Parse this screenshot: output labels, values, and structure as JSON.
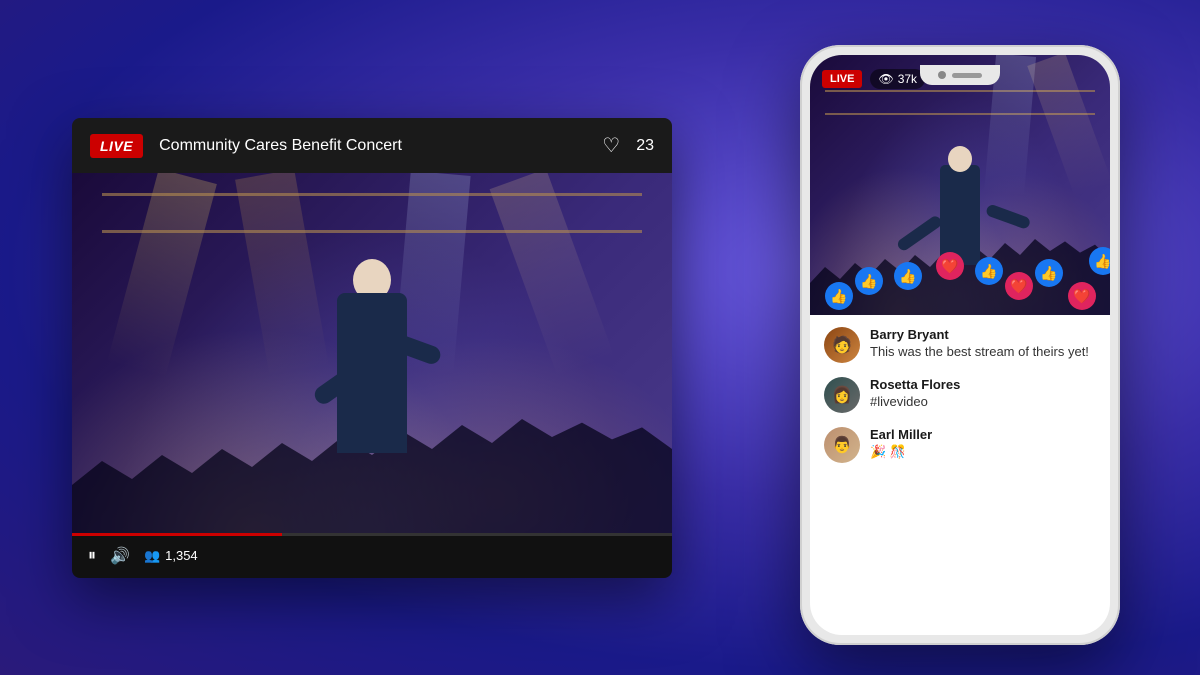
{
  "desktop_player": {
    "live_badge": "LIVE",
    "title": "Community Cares Benefit Concert",
    "heart_icon": "♡",
    "like_count": "23",
    "pause_icon": "⏸",
    "volume_icon": "🔊",
    "viewer_icon": "👥",
    "viewer_count": "1,354",
    "progress_pct": 35
  },
  "phone": {
    "live_badge": "LIVE",
    "viewer_icon": "👁",
    "viewer_count": "37k",
    "reactions": [
      "👍",
      "👍",
      "👍",
      "❤️",
      "👍",
      "❤️",
      "👍",
      "❤️",
      "👍"
    ],
    "comments": [
      {
        "name": "Barry Bryant",
        "text": "This was the best stream of theirs yet!",
        "avatar": "barry"
      },
      {
        "name": "Rosetta Flores",
        "text": "#livevideo",
        "avatar": "rosetta"
      },
      {
        "name": "Earl Miller",
        "text": "🎉 🎊",
        "avatar": "earl"
      }
    ]
  }
}
